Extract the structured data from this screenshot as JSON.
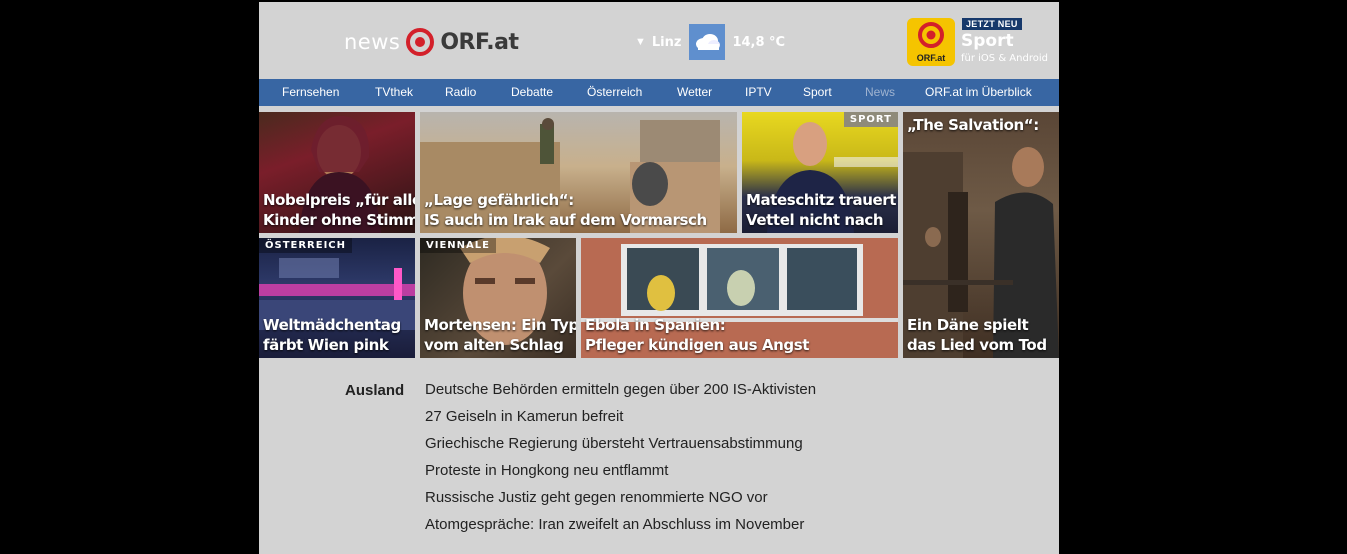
{
  "header": {
    "logo_news": "news",
    "logo_orf": "ORF.at",
    "weather": {
      "city": "Linz",
      "temp": "14,8 °C",
      "icon": "cloud-icon"
    },
    "app": {
      "badge": "JETZT NEU",
      "title": "Sport",
      "platform": "für iOS & Android",
      "icon_label": "ORF.at"
    }
  },
  "nav": {
    "items": [
      {
        "label": "Fernsehen"
      },
      {
        "label": "TVthek"
      },
      {
        "label": "Radio"
      },
      {
        "label": "Debatte"
      },
      {
        "label": "Österreich"
      },
      {
        "label": "Wetter"
      },
      {
        "label": "IPTV"
      },
      {
        "label": "Sport"
      },
      {
        "label": "News",
        "active": true
      },
      {
        "label": "ORF.at im Überblick"
      }
    ]
  },
  "tiles": [
    {
      "lines": [
        "Nobelpreis „für alle",
        "Kinder ohne Stimme“"
      ]
    },
    {
      "lines": [
        "„Lage gefährlich“:",
        "IS auch im Irak auf dem Vormarsch"
      ]
    },
    {
      "tag": "SPORT",
      "lines": [
        "Mateschitz trauert",
        "Vettel nicht nach"
      ]
    },
    {
      "lines": [
        "„The Salvation“:",
        "Ein Däne spielt",
        "das Lied vom Tod"
      ]
    },
    {
      "tag": "ÖSTERREICH",
      "lines": [
        "Weltmädchentag",
        "färbt Wien pink"
      ]
    },
    {
      "tag": "VIENNALE",
      "lines": [
        "Mortensen: Ein Typ",
        "vom alten Schlag"
      ]
    },
    {
      "lines": [
        "Ebola in Spanien:",
        "Pfleger kündigen aus Angst"
      ]
    }
  ],
  "news": {
    "section": "Ausland",
    "items": [
      "Deutsche Behörden ermitteln gegen über 200 IS-Aktivisten",
      "27 Geiseln in Kamerun befreit",
      "Griechische Regierung übersteht Vertrauensabstimmung",
      "Proteste in Hongkong neu entflammt",
      "Russische Justiz geht gegen renommierte NGO vor",
      "Atomgespräche: Iran zweifelt an Abschluss im November"
    ]
  }
}
